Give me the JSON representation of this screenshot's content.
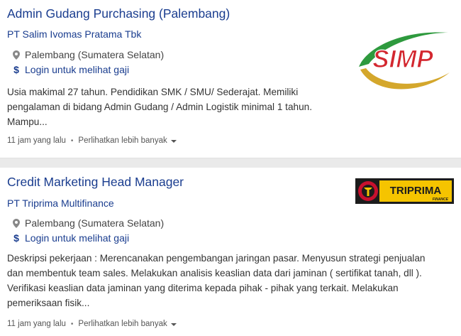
{
  "jobs": [
    {
      "title": "Admin Gudang Purchasing (Palembang)",
      "company": "PT Salim Ivomas Pratama Tbk",
      "location": "Palembang (Sumatera Selatan)",
      "salary": "Login untuk melihat gaji",
      "description": [
        "Usia makimal 27 tahun. Pendidikan SMK / SMU/ Sederajat. Memiliki",
        "pengalaman di bidang Admin Gudang / Admin Logistik minimal 1 tahun.",
        "Mampu..."
      ],
      "posted": "11 jam yang lalu",
      "more_label": "Perlihatkan lebih banyak",
      "logo_text": "SIMP"
    },
    {
      "title": "Credit Marketing Head Manager",
      "company": "PT Triprima Multifinance",
      "location": "Palembang (Sumatera Selatan)",
      "salary": "Login untuk melihat gaji",
      "description": [
        "Deskripsi pekerjaan : Merencanakan pengembangan jaringan pasar. Menyusun strategi penjualan",
        "dan membentuk team sales. Melakukan analisis keaslian data dari jaminan ( sertifikat tanah, dll ).",
        "Verifikasi keaslian data jaminan yang diterima kepada pihak - pihak yang terkait. Melakukan",
        "pemeriksaan fisik..."
      ],
      "posted": "11 jam yang lalu",
      "more_label": "Perlihatkan lebih banyak",
      "logo_text": "TRIPRIMA",
      "logo_subtext": "FINANCE"
    }
  ],
  "icons": {
    "location": "map-pin-icon",
    "salary": "dollar-icon",
    "caret": "caret-down-icon"
  },
  "colors": {
    "link": "#1a3d8f",
    "simp_red": "#d3272f",
    "simp_green": "#2e9a3e",
    "simp_gold": "#d4a72c",
    "triprima_yellow": "#f5c400",
    "triprima_red": "#c8102e"
  }
}
